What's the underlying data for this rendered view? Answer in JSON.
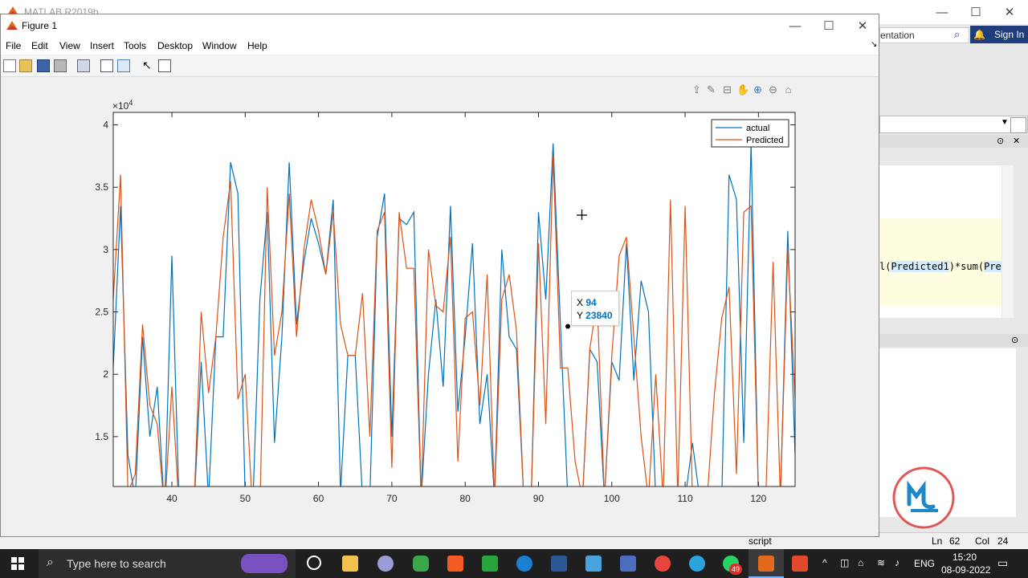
{
  "main_window": {
    "title": "MATLAB R2019b",
    "doc_search_text": "entation",
    "sign_in": "Sign In",
    "code_fragment_a": "l(",
    "code_fragment_hl": "Predicted1",
    "code_fragment_b": ")*sum(",
    "code_fragment_c": "Pre",
    "status_left": "script",
    "status_ln_label": "Ln",
    "status_ln": "62",
    "status_col_label": "Col",
    "status_col": "24"
  },
  "figure": {
    "title": "Figure 1",
    "menu": [
      "File",
      "Edit",
      "View",
      "Insert",
      "Tools",
      "Desktop",
      "Window",
      "Help"
    ]
  },
  "datatip": {
    "x_label": "X",
    "x_value": "94",
    "y_label": "Y",
    "y_value": "23840"
  },
  "taskbar": {
    "search_placeholder": "Type here to search",
    "lang": "ENG",
    "time": "15:20",
    "date": "08-09-2022",
    "whatsapp_badge": "49"
  },
  "colors": {
    "actual": "#0072BD",
    "predicted": "#D95319",
    "accent": "#0072BD"
  },
  "chart_data": {
    "type": "line",
    "title": "",
    "xlabel": "",
    "ylabel": "",
    "y_exponent_label": "×10",
    "y_exponent": "4",
    "xlim": [
      32,
      125
    ],
    "ylim": [
      11000,
      41000
    ],
    "xticks": [
      40,
      50,
      60,
      70,
      80,
      90,
      100,
      110,
      120
    ],
    "yticks": [
      15000,
      20000,
      25000,
      30000,
      35000,
      40000
    ],
    "ytick_labels": [
      "1.5",
      "2",
      "2.5",
      "3",
      "3.5",
      "4"
    ],
    "legend_position": "top-right",
    "grid": false,
    "x": [
      32,
      33,
      34,
      35,
      36,
      37,
      38,
      39,
      40,
      41,
      42,
      43,
      44,
      45,
      46,
      47,
      48,
      49,
      50,
      51,
      52,
      53,
      54,
      55,
      56,
      57,
      58,
      59,
      60,
      61,
      62,
      63,
      64,
      65,
      66,
      67,
      68,
      69,
      70,
      71,
      72,
      73,
      74,
      75,
      76,
      77,
      78,
      79,
      80,
      81,
      82,
      83,
      84,
      85,
      86,
      87,
      88,
      89,
      90,
      91,
      92,
      93,
      94,
      95,
      96,
      97,
      98,
      99,
      100,
      101,
      102,
      103,
      104,
      105,
      106,
      107,
      108,
      109,
      110,
      111,
      112,
      113,
      114,
      115,
      116,
      117,
      118,
      119,
      120,
      121,
      122,
      123,
      124,
      125
    ],
    "series": [
      {
        "name": "actual",
        "values": [
          20500,
          33500,
          13500,
          10000,
          23000,
          15000,
          19000,
          9000,
          29500,
          9000,
          9000,
          9000,
          21000,
          10000,
          23000,
          23000,
          37000,
          34500,
          10000,
          9000,
          26000,
          33000,
          14500,
          23000,
          37000,
          24000,
          29000,
          32500,
          30500,
          28000,
          34000,
          10500,
          21500,
          21500,
          10000,
          10000,
          31000,
          34500,
          15000,
          32500,
          32000,
          33000,
          10000,
          20000,
          26000,
          19000,
          33500,
          17000,
          23000,
          30500,
          16000,
          20000,
          10000,
          30000,
          23000,
          22000,
          10000,
          10000,
          33000,
          26000,
          38500,
          23840,
          10000,
          10000,
          10000,
          22000,
          21000,
          10000,
          21000,
          19500,
          30500,
          19500,
          27500,
          25000,
          10000,
          10000,
          10000,
          10000,
          10000,
          14500,
          10000,
          10000,
          10000,
          10000,
          36000,
          34000,
          14500,
          38500,
          10000,
          10000,
          10000,
          10000,
          31500,
          13500
        ]
      },
      {
        "name": "Predicted",
        "values": [
          26000,
          36000,
          10500,
          12000,
          24000,
          17500,
          16000,
          9000,
          19000,
          9000,
          9000,
          9000,
          25000,
          18500,
          23000,
          31000,
          35500,
          18000,
          20000,
          9000,
          9000,
          35000,
          21500,
          25000,
          34500,
          23000,
          30000,
          34000,
          31500,
          28000,
          33000,
          24000,
          21500,
          21500,
          26500,
          15000,
          31500,
          33000,
          12500,
          33000,
          28500,
          28500,
          10000,
          30000,
          25500,
          25000,
          31000,
          13000,
          24500,
          25000,
          17500,
          28000,
          10000,
          26000,
          28000,
          23500,
          10000,
          10000,
          30500,
          16000,
          37500,
          20500,
          20500,
          13000,
          10000,
          22000,
          26000,
          10000,
          21500,
          29500,
          31000,
          23000,
          15000,
          10000,
          20000,
          10000,
          34000,
          10000,
          33500,
          10000,
          10000,
          10000,
          18500,
          24500,
          27000,
          12000,
          33000,
          33500,
          10000,
          10000,
          29000,
          10000,
          30000,
          18000
        ]
      }
    ]
  }
}
